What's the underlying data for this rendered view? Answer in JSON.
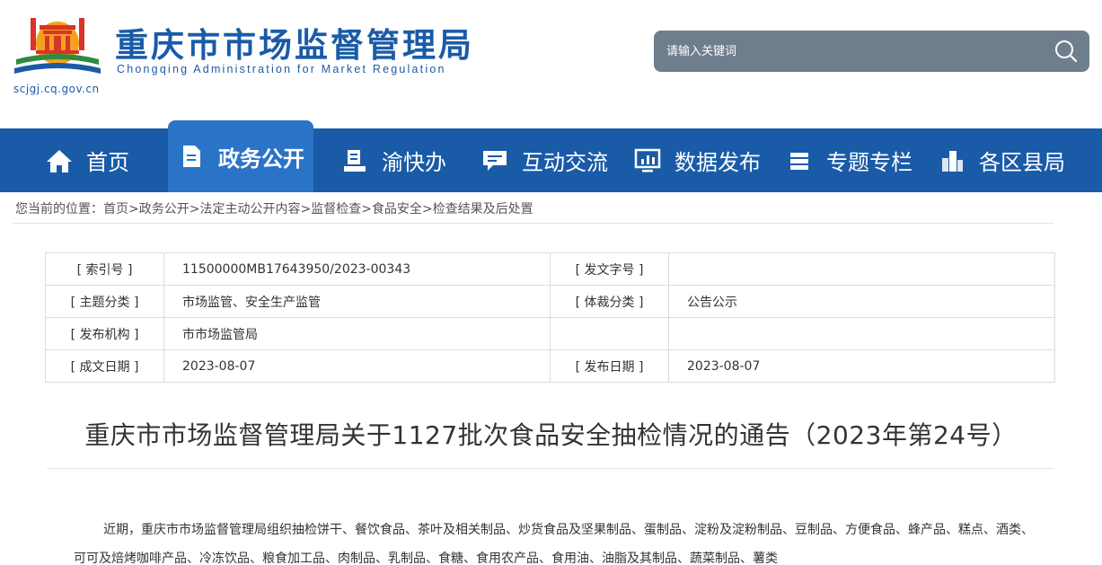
{
  "header": {
    "title": "重庆市市场监督管理局",
    "subtitle": "Chongqing  Administration for Market Regulation",
    "url": "scjgj.cq.gov.cn",
    "logo_icon": "emblem-icon"
  },
  "search": {
    "placeholder": "请输入关键词",
    "icon": "search-icon"
  },
  "nav": {
    "items": [
      {
        "label": "首页",
        "icon": "home-icon"
      },
      {
        "label": "政务公开",
        "icon": "document-icon",
        "active": true
      },
      {
        "label": "渝快办",
        "icon": "stamp-icon"
      },
      {
        "label": "互动交流",
        "icon": "chat-icon"
      },
      {
        "label": "数据发布",
        "icon": "chart-icon"
      },
      {
        "label": "专题专栏",
        "icon": "stack-icon"
      },
      {
        "label": "各区县局",
        "icon": "buildings-icon"
      }
    ]
  },
  "breadcrumb": {
    "prefix": "您当前的位置：",
    "items": [
      "首页",
      "政务公开",
      "法定主动公开内容",
      "监督检查",
      "食品安全",
      "检查结果及后处置"
    ],
    "separator": ">"
  },
  "meta": {
    "rows": [
      {
        "k1": "[ 索引号 ]",
        "v1": "11500000MB17643950/2023-00343",
        "k2": "[ 发文字号 ]",
        "v2": ""
      },
      {
        "k1": "[ 主题分类 ]",
        "v1": "市场监管、安全生产监管",
        "k2": "[ 体裁分类 ]",
        "v2": "公告公示"
      },
      {
        "k1": "[ 发布机构 ]",
        "v1": "市市场监管局",
        "k2": "",
        "v2": ""
      },
      {
        "k1": "[ 成文日期 ]",
        "v1": "2023-08-07",
        "k2": "[ 发布日期 ]",
        "v2": "2023-08-07"
      }
    ]
  },
  "document": {
    "title": "重庆市市场监督管理局关于1127批次食品安全抽检情况的通告（2023年第24号）",
    "body": "近期，重庆市市场监督管理局组织抽检饼干、餐饮食品、茶叶及相关制品、炒货食品及坚果制品、蛋制品、淀粉及淀粉制品、豆制品、方便食品、蜂产品、糕点、酒类、可可及焙烤咖啡产品、冷冻饮品、粮食加工品、肉制品、乳制品、食糖、食用农产品、食用油、油脂及其制品、蔬菜制品、薯类"
  },
  "colors": {
    "brand_blue": "#1a5ba8",
    "active_tab": "#2a73c7",
    "search_bg": "#6f7e8c"
  }
}
